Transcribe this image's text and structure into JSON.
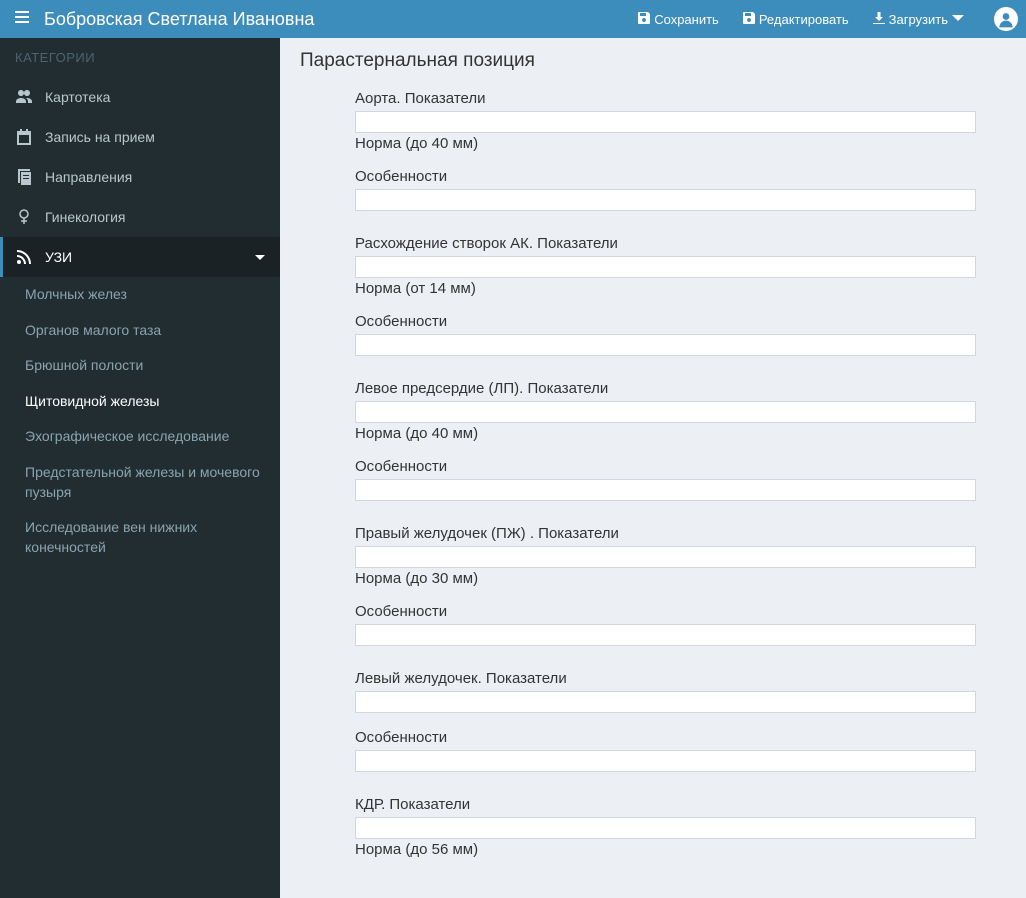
{
  "header": {
    "title": "Бобровская Светлана Ивановна",
    "save": "Сохранить",
    "edit": "Редактировать",
    "download": "Загрузить"
  },
  "sidebar": {
    "category_label": "КАТЕГОРИИ",
    "items": [
      {
        "key": "kartoteka",
        "label": "Картотека"
      },
      {
        "key": "zapis",
        "label": "Запись на прием"
      },
      {
        "key": "napravleniya",
        "label": "Направления"
      },
      {
        "key": "ginekologiya",
        "label": "Гинекология"
      },
      {
        "key": "uzi",
        "label": "УЗИ"
      }
    ],
    "sub_items": [
      {
        "key": "molochnyh",
        "label": "Молчных желез"
      },
      {
        "key": "taz",
        "label": "Органов малого таза"
      },
      {
        "key": "bryushnoy",
        "label": "Брюшной полости"
      },
      {
        "key": "shchitovidnoy",
        "label": "Щитовидной железы"
      },
      {
        "key": "ehograf",
        "label": "Эхографическое исследование"
      },
      {
        "key": "predstatelnoy",
        "label": "Предстательной железы и мочевого пузыря"
      },
      {
        "key": "ven",
        "label": "Исследование вен нижних конечностей"
      }
    ]
  },
  "page": {
    "title": "Парастернальная позиция"
  },
  "form": {
    "groups": [
      {
        "label": "Аорта. Показатели",
        "hint": "Норма (до 40 мм)",
        "value": ""
      },
      {
        "label": "Особенности",
        "hint": "",
        "value": ""
      },
      {
        "label": "Расхождение створок АК. Показатели",
        "hint": "Норма (от 14 мм)",
        "value": ""
      },
      {
        "label": "Особенности",
        "hint": "",
        "value": ""
      },
      {
        "label": "Левое предсердие (ЛП). Показатели",
        "hint": "Норма (до 40 мм)",
        "value": ""
      },
      {
        "label": "Особенности",
        "hint": "",
        "value": ""
      },
      {
        "label": "Правый желудочек (ПЖ) . Показатели",
        "hint": "Норма (до 30 мм)",
        "value": ""
      },
      {
        "label": "Особенности",
        "hint": "",
        "value": ""
      },
      {
        "label": "Левый желудочек. Показатели",
        "hint": "",
        "value": ""
      },
      {
        "label": "Особенности",
        "hint": "",
        "value": ""
      },
      {
        "label": "КДР. Показатели",
        "hint": "Норма (до 56 мм)",
        "value": ""
      }
    ]
  }
}
